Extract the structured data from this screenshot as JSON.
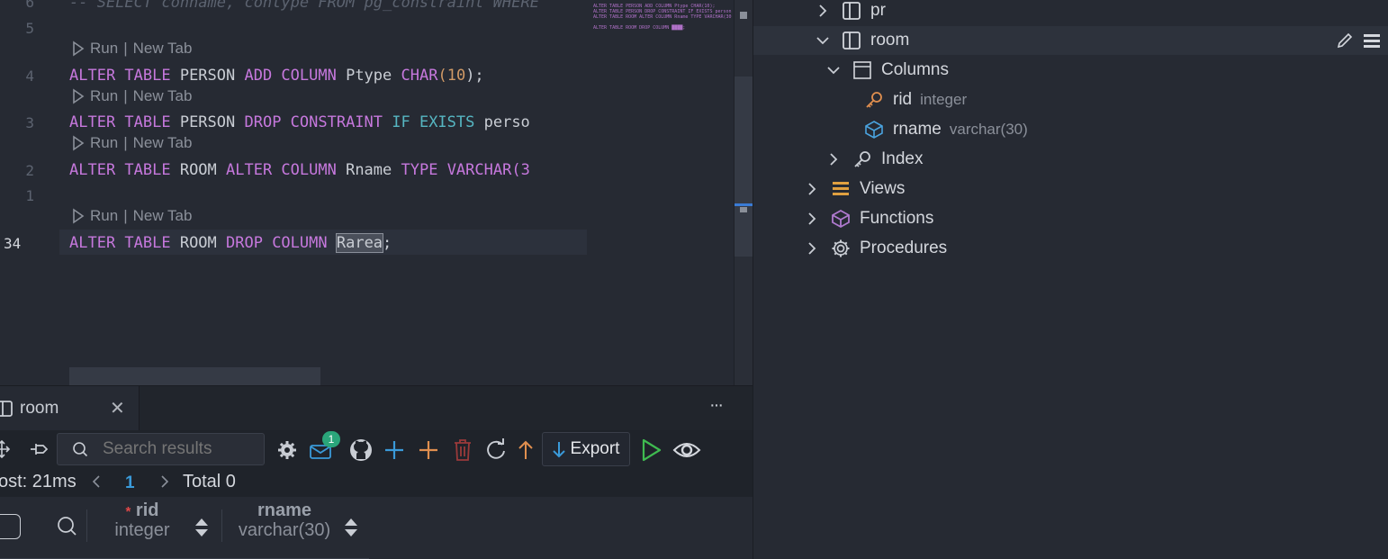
{
  "editor": {
    "comment_line": "-- SELECT conname, contype FROM pg_constraint WHERE",
    "line_numbers": [
      "6",
      "5",
      "4",
      "3",
      "2",
      "1",
      "34"
    ],
    "lens_run": "Run",
    "lens_sep": "|",
    "lens_newtab": "New Tab",
    "stmt1": {
      "a": "ALTER TABLE",
      "b": " PERSON ",
      "c": "ADD COLUMN",
      "d": " Ptype ",
      "e": "CHAR",
      "f": "(",
      "g": "10",
      "h": ");"
    },
    "stmt2": {
      "a": "ALTER TABLE",
      "b": " PERSON ",
      "c": "DROP CONSTRAINT",
      "d": " IF EXISTS",
      "e": " perso"
    },
    "stmt3": {
      "a": "ALTER TABLE",
      "b": " ROOM ",
      "c": "ALTER COLUMN",
      "d": " Rname ",
      "e": "TYPE",
      "f": " VARCHAR(3"
    },
    "stmt4": {
      "a": "ALTER TABLE",
      "b": " ROOM ",
      "c": "DROP COLUMN",
      "d": " ",
      "e": "Rarea",
      "f": ";"
    },
    "minimap": [
      "ALTER TABLE PERSON ADD COLUMN Ptype CHAR(10);",
      "ALTER TABLE PERSON DROP CONSTRAINT IF EXISTS person",
      "ALTER TABLE ROOM ALTER COLUMN Rname TYPE VARCHAR(30",
      "",
      "ALTER TABLE ROOM DROP COLUMN ████;"
    ]
  },
  "explorer": {
    "pr": "pr",
    "room": "room",
    "columns": "Columns",
    "col1_name": "rid",
    "col1_type": "integer",
    "col2_name": "rname",
    "col2_type": "varchar(30)",
    "index": "Index",
    "views": "Views",
    "functions": "Functions",
    "procedures": "Procedures"
  },
  "results": {
    "tab_label": "room",
    "close_glyph": "✕",
    "more_glyph": "···",
    "search_placeholder": "Search results",
    "badge_count": "1",
    "export_label": "Export",
    "cost_text": "ost: 21ms",
    "page_number": "1",
    "total_text": "Total 0",
    "col1_required": "*",
    "col1_name": "rid",
    "col1_type": "integer",
    "col2_name": "rname",
    "col2_type": "varchar(30)"
  },
  "colors": {
    "keyword": "#c678dd",
    "builtin": "#56b6c2",
    "number": "#d19a66",
    "key_icon": "#e08f4f",
    "column_icon": "#4aa3df",
    "views_icon": "#e0a040",
    "functions_icon": "#b07ad0",
    "badge": "#2aa57a",
    "accent_blue": "#3a9ad9"
  }
}
